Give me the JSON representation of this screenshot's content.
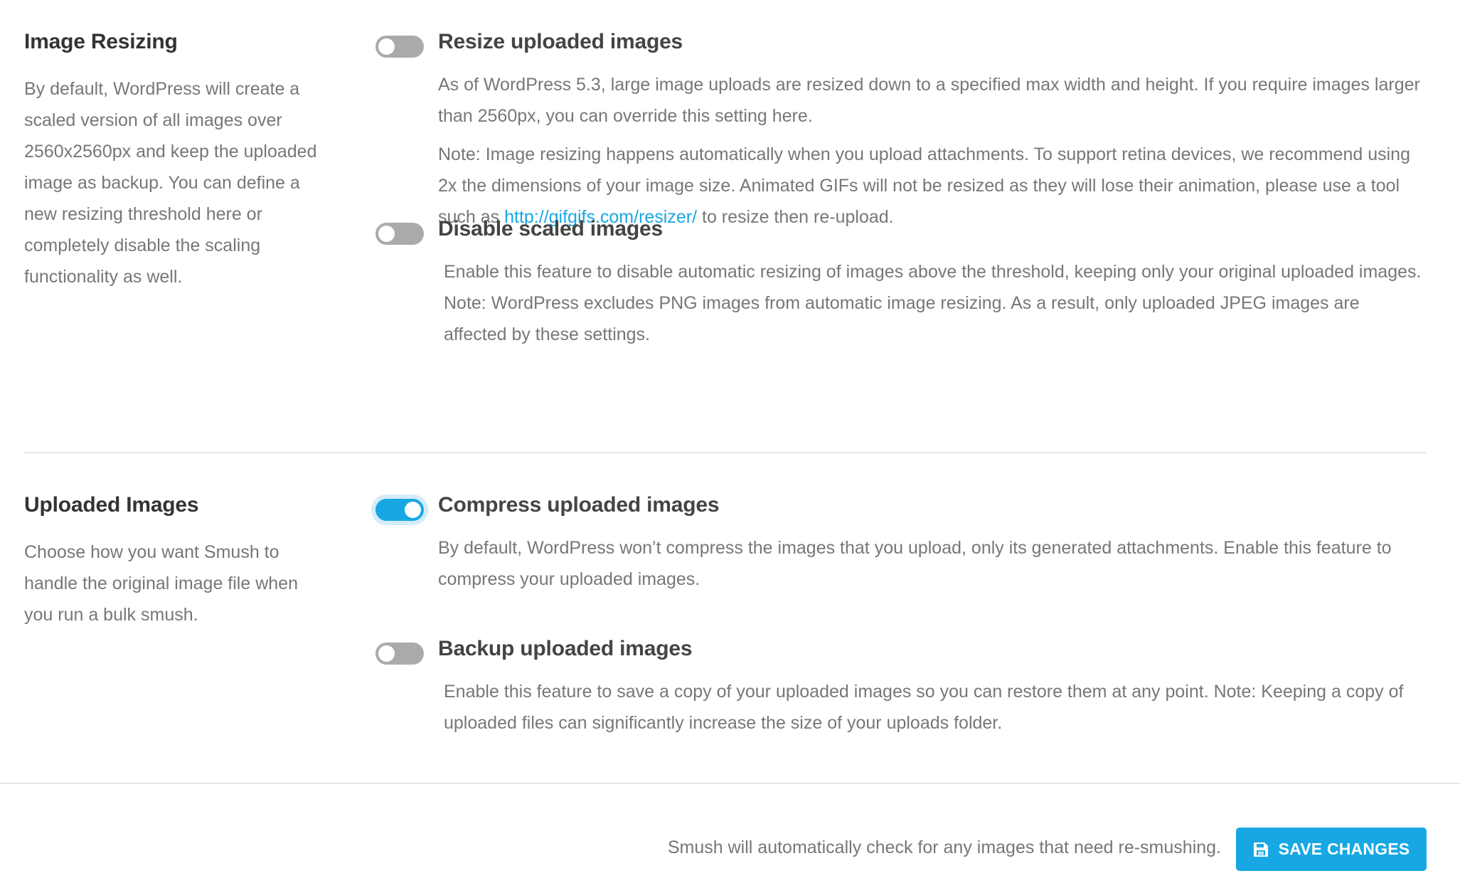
{
  "image_resizing": {
    "title": "Image Resizing",
    "description": "By default, WordPress will create a scaled version of all images over 2560x2560px and keep the uploaded image as backup. You can define a new resizing threshold here or completely disable the scaling functionality as well.",
    "resize": {
      "label": "Resize uploaded images",
      "enabled": false,
      "desc": "As of WordPress 5.3, large image uploads are resized down to a specified max width and height. If you require images larger than 2560px, you can override this setting here.",
      "note_prefix": "Note: Image resizing happens automatically when you upload attachments. To support retina devices, we recommend using 2x the dimensions of your image size. Animated GIFs will not be resized as they will lose their animation, please use a tool such as ",
      "note_link": "http://gifgifs.com/resizer/",
      "note_suffix": " to resize then re-upload."
    },
    "disable_scaled": {
      "label": "Disable scaled images",
      "enabled": false,
      "desc": "Enable this feature to disable automatic resizing of images above the threshold, keeping only your original uploaded images. Note: WordPress excludes PNG images from automatic image resizing. As a result, only uploaded JPEG images are affected by these settings."
    }
  },
  "uploaded_images": {
    "title": "Uploaded Images",
    "description": "Choose how you want Smush to handle the original image file when you run a bulk smush.",
    "compress": {
      "label": "Compress uploaded images",
      "enabled": true,
      "desc": "By default, WordPress won’t compress the images that you upload, only its generated attachments. Enable this feature to compress your uploaded images."
    },
    "backup": {
      "label": "Backup uploaded images",
      "enabled": false,
      "desc": "Enable this feature to save a copy of your uploaded images so you can restore them at any point. Note: Keeping a copy of uploaded files can significantly increase the size of your uploads folder."
    }
  },
  "footer": {
    "note": "Smush will automatically check for any images that need re-smushing.",
    "save_label": "SAVE CHANGES",
    "save_icon": "floppy-disk-icon"
  },
  "colors": {
    "accent": "#17a8e3",
    "toggle_off": "#aaaaaa",
    "text": "#777777",
    "heading": "#333333"
  }
}
